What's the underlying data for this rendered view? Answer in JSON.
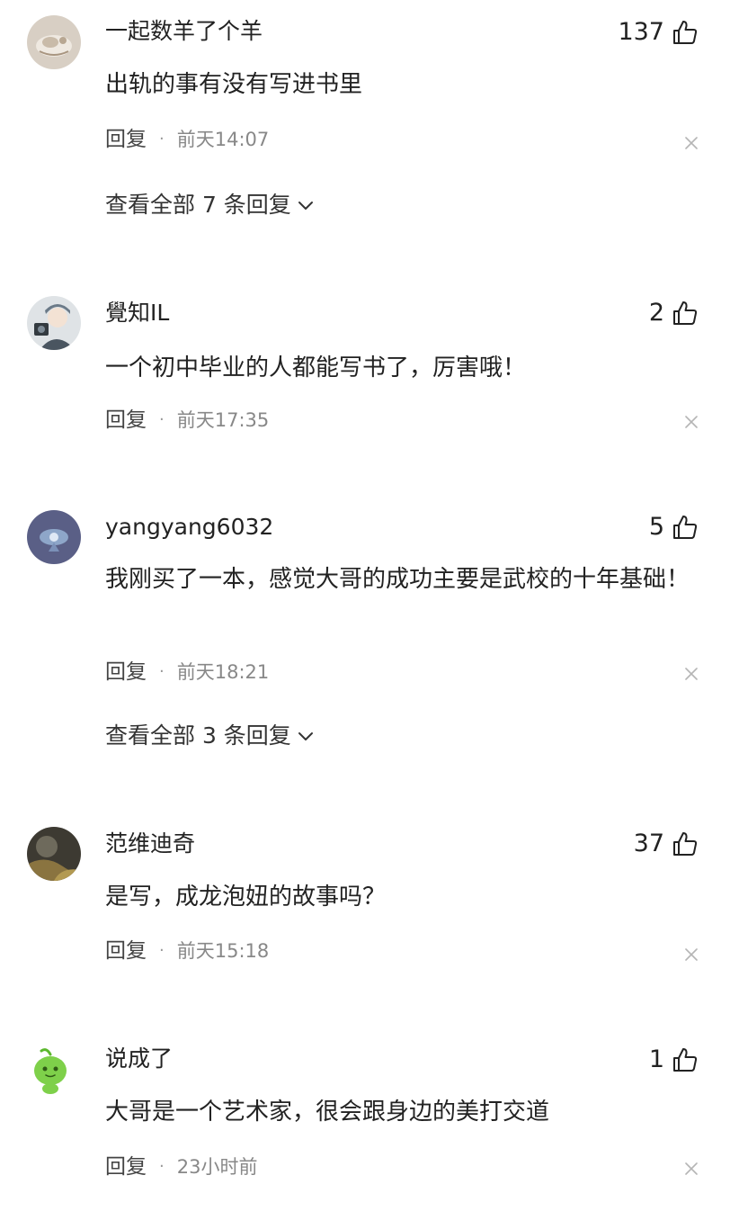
{
  "comments": [
    {
      "username": "一起数羊了个羊",
      "likes": "137",
      "content": "出轨的事有没有写进书里",
      "reply_label": "回复",
      "dot": "·",
      "time": "前天14:07",
      "view_all": "查看全部 7 条回复"
    },
    {
      "username": "覺知IL",
      "likes": "2",
      "content": "一个初中毕业的人都能写书了，厉害哦！",
      "reply_label": "回复",
      "dot": "·",
      "time": "前天17:35"
    },
    {
      "username": "yangyang6032",
      "likes": "5",
      "content": "我刚买了一本，感觉大哥的成功主要是武校的十年基础！",
      "reply_label": "回复",
      "dot": "·",
      "time": "前天18:21",
      "view_all": "查看全部 3 条回复"
    },
    {
      "username": "范维迪奇",
      "likes": "37",
      "content": "是写，成龙泡妞的故事吗？",
      "reply_label": "回复",
      "dot": "·",
      "time": "前天15:18"
    },
    {
      "username": "说成了",
      "likes": "1",
      "content": "大哥是一个艺术家，很会跟身边的美打交道",
      "reply_label": "回复",
      "dot": "·",
      "time": "23小时前"
    }
  ],
  "icons": {
    "like": "thumbs-up-icon",
    "close": "close-icon",
    "expand": "chevron-down-icon"
  }
}
